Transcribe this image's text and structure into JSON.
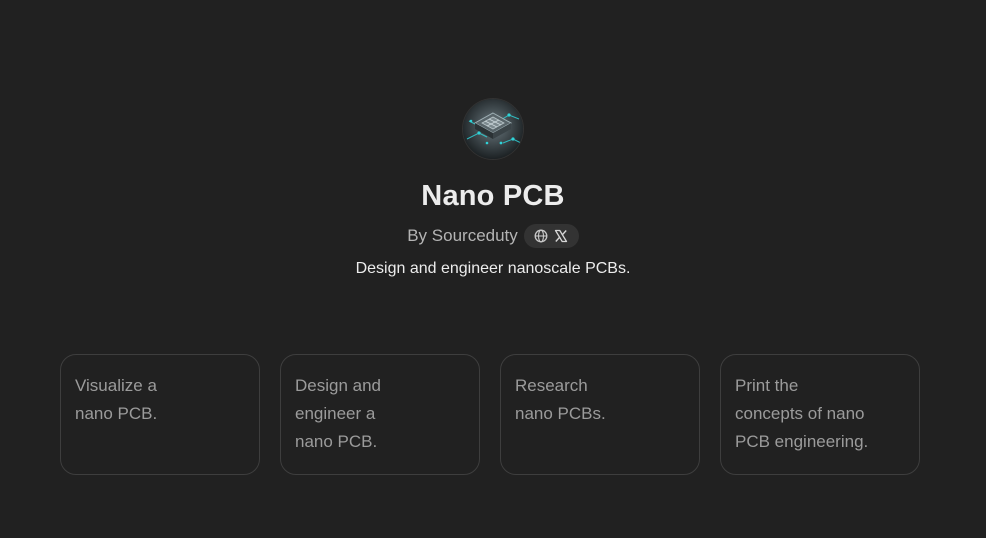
{
  "gpt": {
    "avatar_icon": "circuit-chip-icon",
    "title": "Nano PCB",
    "author": "By Sourceduty",
    "social_icons": [
      "globe-icon",
      "x-icon"
    ],
    "description": "Design and engineer nanoscale PCBs."
  },
  "starters": [
    {
      "label": "Visualize a\nnano PCB."
    },
    {
      "label": "Design and\nengineer a\nnano PCB."
    },
    {
      "label": "Research\nnano PCBs."
    },
    {
      "label": "Print the\nconcepts of nano\nPCB engineering."
    }
  ],
  "colors": {
    "background": "#212121",
    "title": "#ececec",
    "muted": "#b4b4b4",
    "card_border": "#3e3e3e",
    "card_text": "#9b9b9b",
    "circuit_glow": "#2fd3d8"
  }
}
